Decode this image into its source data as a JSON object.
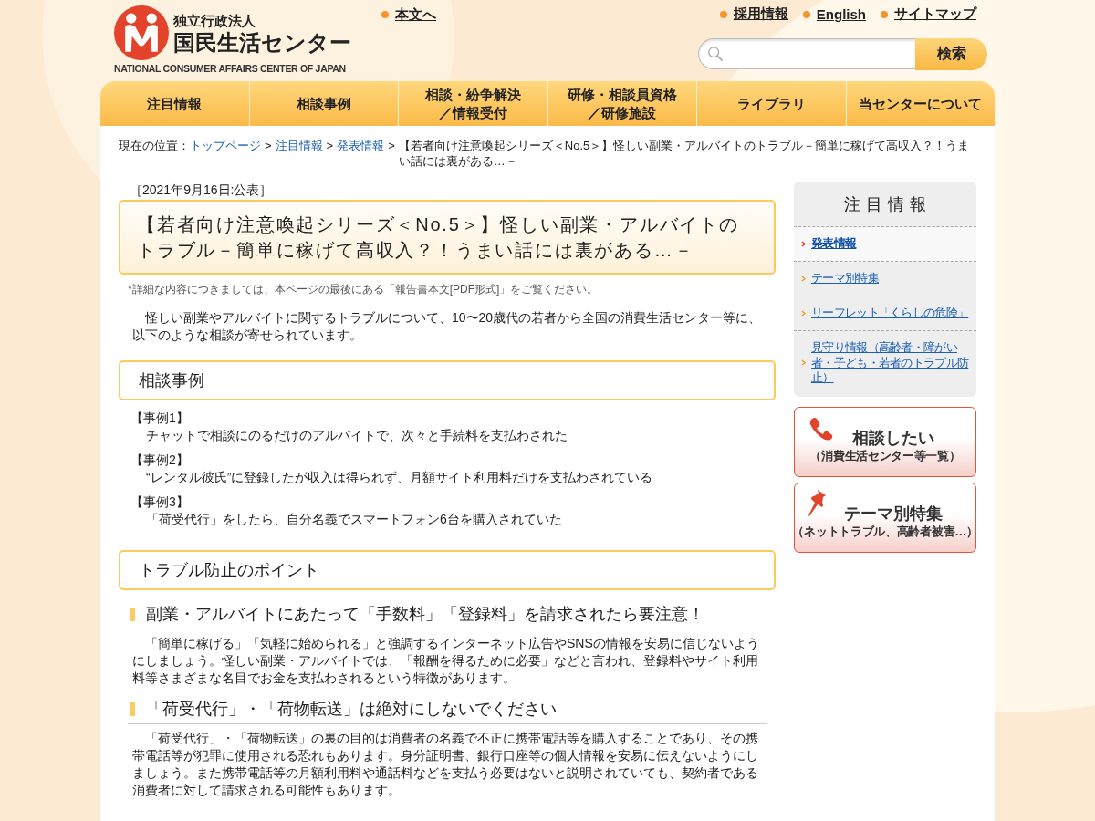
{
  "header": {
    "logo": {
      "org_type": "独立行政法人",
      "name": "国民生活センター",
      "english_name": "NATIONAL CONSUMER AFFAIRS CENTER OF JAPAN"
    },
    "skip_link": "本文へ",
    "utility_links": [
      "採用情報",
      "English",
      "サイトマップ"
    ],
    "search": {
      "button": "検索"
    }
  },
  "nav": {
    "items": [
      {
        "lines": [
          "注目情報"
        ]
      },
      {
        "lines": [
          "相談事例"
        ]
      },
      {
        "lines": [
          "相談・紛争解決",
          "／情報受付"
        ]
      },
      {
        "lines": [
          "研修・相談員資格",
          "／研修施設"
        ]
      },
      {
        "lines": [
          "ライブラリ"
        ]
      },
      {
        "lines": [
          "当センターについて"
        ]
      }
    ]
  },
  "breadcrumb": {
    "label": "現在の位置：",
    "items": [
      {
        "kind": "link",
        "text": "トップページ"
      },
      {
        "kind": "separator",
        "text": ">"
      },
      {
        "kind": "link",
        "text": "注目情報"
      },
      {
        "kind": "separator",
        "text": ">"
      },
      {
        "kind": "link",
        "text": "発表情報"
      },
      {
        "kind": "separator",
        "text": ">"
      },
      {
        "kind": "current",
        "text": "【若者向け注意喚起シリーズ＜No.5＞】怪しい副業・アルバイトのトラブル－簡単に稼げて高収入？！うまい話には裏がある…－"
      }
    ]
  },
  "article": {
    "date": "［2021年9月16日:公表］",
    "title": "【若者向け注意喚起シリーズ＜No.5＞】怪しい副業・アルバイトのトラブル－簡単に稼げて高収入？！うまい話には裏がある…－",
    "note": "*詳細な内容につきましては、本ページの最後にある「報告書本文[PDF形式]」をご覧ください。",
    "intro": "怪しい副業やアルバイトに関するトラブルについて、10〜20歳代の若者から全国の消費生活センター等に、以下のような相談が寄せられています。",
    "sections": [
      {
        "kind": "cases",
        "heading": "相談事例",
        "items": [
          {
            "label": "【事例1】",
            "text": "チャットで相談にのるだけのアルバイトで、次々と手続料を支払わされた"
          },
          {
            "label": "【事例2】",
            "text": "“レンタル彼氏”に登録したが収入は得られず、月額サイト利用料だけを支払わされている"
          },
          {
            "label": "【事例3】",
            "text": "「荷受代行」をしたら、自分名義でスマートフォン6台を購入されていた"
          }
        ]
      },
      {
        "kind": "points",
        "heading": "トラブル防止のポイント",
        "items": [
          {
            "heading": "副業・アルバイトにあたって「手数料」「登録料」を請求されたら要注意！",
            "text": "「簡単に稼げる」「気軽に始められる」と強調するインターネット広告やSNSの情報を安易に信じないようにしましょう。怪しい副業・アルバイトでは、「報酬を得るために必要」などと言われ、登録料やサイト利用料等さまざまな名目でお金を支払わされるという特徴があります。"
          },
          {
            "heading": "「荷受代行」・「荷物転送」は絶対にしないでください",
            "text": "「荷受代行」・「荷物転送」の裏の目的は消費者の名義で不正に携帯電話等を購入することであり、その携帯電話等が犯罪に使用される恐れもあります。身分証明書、銀行口座等の個人情報を安易に伝えないようにしましょう。また携帯電話等の月額利用料や通話料などを支払う必要はないと説明されていても、契約者である消費者に対して請求される可能性もあります。"
          }
        ]
      }
    ]
  },
  "sidebar": {
    "title": "注目情報",
    "items": [
      {
        "label": "発表情報",
        "selected": true
      },
      {
        "label": "テーマ別特集",
        "selected": false
      },
      {
        "label": "リーフレット「くらしの危険」",
        "selected": false
      },
      {
        "label": "見守り情報（高齢者・障がい者・子ども・若者のトラブル防止）",
        "selected": false
      }
    ],
    "banners": [
      {
        "kind": "phone",
        "title": "相談したい",
        "subtitle": "（消費生活センター等一覧）"
      },
      {
        "kind": "pin",
        "title": "テーマ別特集",
        "subtitle": "（ネットトラブル、高齢者被害…）"
      }
    ]
  }
}
